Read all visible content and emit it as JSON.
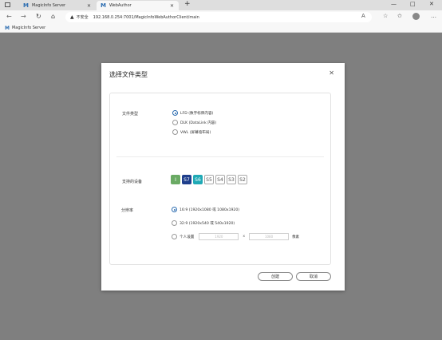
{
  "browser": {
    "tabs": [
      {
        "label": "MagicInfo Server",
        "active": false
      },
      {
        "label": "WebAuthor",
        "active": true
      }
    ],
    "new_tab": "+",
    "insecure_label": "不安全",
    "url": "192.168.0.254:7001/MagicInfoWebAuthorClient/main",
    "bookmark": "MagicInfo Server",
    "window_controls": {
      "minimize": "—",
      "maximize": "□",
      "close": "✕"
    }
  },
  "dialog": {
    "title": "选择文件类型",
    "close": "✕",
    "file_type": {
      "label": "文件类型",
      "options": [
        {
          "text": "LFD (数字标牌内容)",
          "selected": true
        },
        {
          "text": "DLK (DataLink 内容)",
          "selected": false
        },
        {
          "text": "VWL (屏幕墙布局)",
          "selected": false
        }
      ]
    },
    "devices": {
      "label": "支持的设备",
      "items": [
        "I",
        "S7",
        "S6",
        "S5",
        "S4",
        "S3",
        "S2"
      ]
    },
    "resolution": {
      "label": "分辨率",
      "options": [
        {
          "text": "16:9 (1920x1080 或 1080x1920)",
          "selected": true
        },
        {
          "text": "32:9 (1920x540 或 540x1920)",
          "selected": false
        },
        {
          "text": "个人设置",
          "selected": false
        }
      ],
      "width_placeholder": "1920",
      "height_placeholder": "1080",
      "separator": "x",
      "unit": "像素"
    },
    "buttons": {
      "create": "创建",
      "cancel": "取消"
    }
  }
}
